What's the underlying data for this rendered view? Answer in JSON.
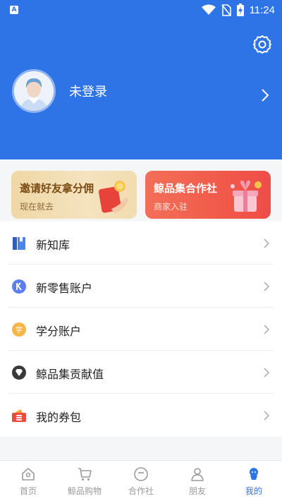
{
  "status_bar": {
    "time": "11:24",
    "app_badge": "A"
  },
  "profile": {
    "login_text": "未登录"
  },
  "banners": [
    {
      "title": "邀请好友拿分佣",
      "subtitle": "现在就去"
    },
    {
      "title": "鲸品集合作社",
      "subtitle": "商家入驻"
    }
  ],
  "menu": [
    {
      "label": "新知库",
      "icon": "book-icon"
    },
    {
      "label": "新零售账户",
      "icon": "k-coin-icon"
    },
    {
      "label": "学分账户",
      "icon": "credit-icon"
    },
    {
      "label": "鲸品集贡献值",
      "icon": "diamond-icon"
    },
    {
      "label": "我的券包",
      "icon": "coupon-icon"
    }
  ],
  "bottom_nav": [
    {
      "label": "首页",
      "active": false
    },
    {
      "label": "鲸品购物",
      "active": false
    },
    {
      "label": "合作社",
      "active": false
    },
    {
      "label": "朋友",
      "active": false
    },
    {
      "label": "我的",
      "active": true
    }
  ],
  "colors": {
    "primary": "#2f74e6",
    "inactive": "#9a9a9a"
  }
}
